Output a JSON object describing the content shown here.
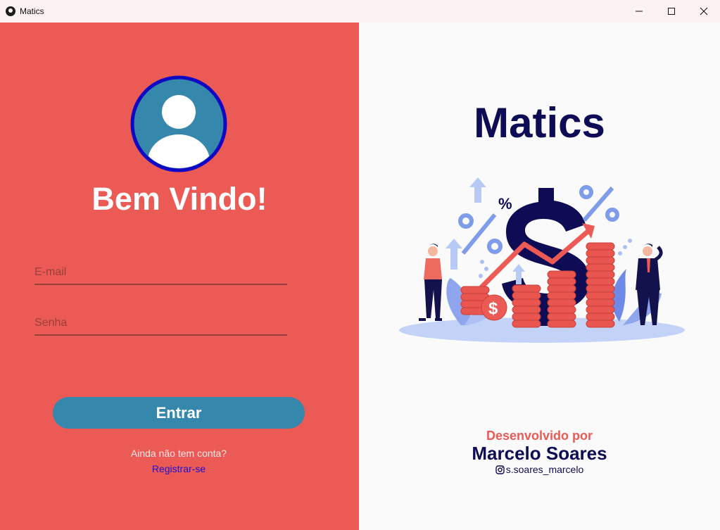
{
  "window": {
    "title": "Matics",
    "app_icon": "app-logo-icon",
    "controls": [
      "minimize-icon",
      "maximize-icon",
      "close-icon"
    ]
  },
  "login": {
    "welcome": "Bem Vindo!",
    "avatar_icon": "user-avatar-icon",
    "email_placeholder": "E-mail",
    "password_placeholder": "Senha",
    "submit_label": "Entrar",
    "no_account_text": "Ainda não tem conta?",
    "register_label": "Registrar-se"
  },
  "brand": {
    "name": "Matics",
    "illustration": "finance-illustration",
    "developed_by": "Desenvolvido por",
    "developer": "Marcelo Soares",
    "instagram_icon": "instagram-icon",
    "instagram_handle": "s.soares_marcelo"
  },
  "colors": {
    "left_panel": "#ec5a55",
    "accent_blue": "#3587ac",
    "navy": "#0e0c55",
    "link": "#1a10d8"
  }
}
